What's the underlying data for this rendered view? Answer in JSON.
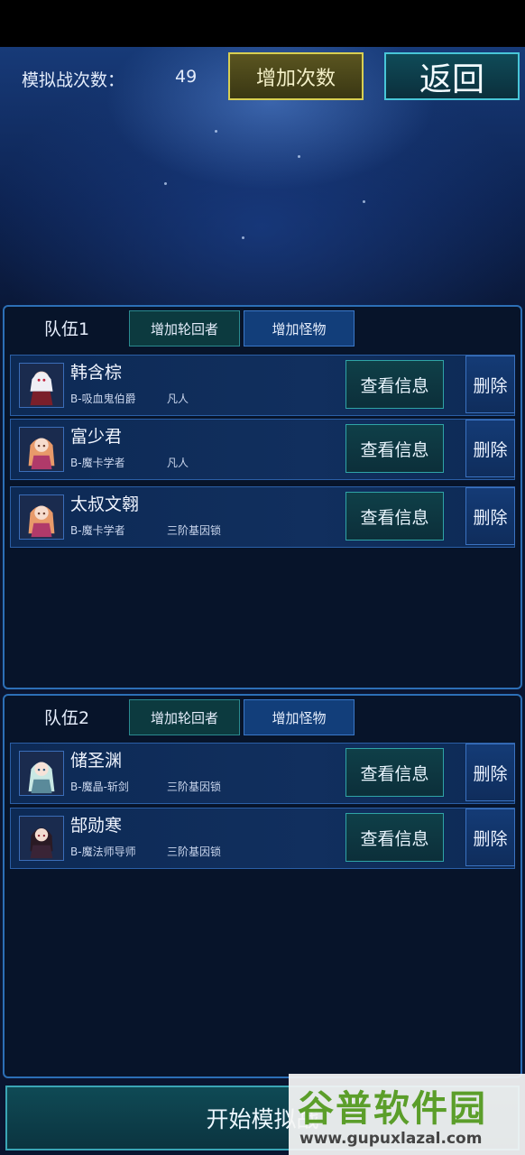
{
  "header": {
    "count_label": "模拟战次数：",
    "count_value": "49",
    "add_count_button": "增加次数",
    "back_button": "返回"
  },
  "teams": [
    {
      "title": "队伍1",
      "add_reincarnator": "增加轮回者",
      "add_monster": "增加怪物",
      "members": [
        {
          "name": "韩含棕",
          "class": "B-吸血鬼伯爵",
          "rank": "凡人",
          "info": "查看信息",
          "delete": "删除",
          "avatar_icon": "vampire-girl-avatar-icon"
        },
        {
          "name": "富少君",
          "class": "B-魔卡学者",
          "rank": "凡人",
          "info": "查看信息",
          "delete": "删除",
          "avatar_icon": "card-scholar-avatar-icon"
        },
        {
          "name": "太叔文翱",
          "class": "B-魔卡学者",
          "rank": "三阶基因锁",
          "info": "查看信息",
          "delete": "删除",
          "avatar_icon": "card-scholar-avatar-icon"
        }
      ]
    },
    {
      "title": "队伍2",
      "add_reincarnator": "增加轮回者",
      "add_monster": "增加怪物",
      "members": [
        {
          "name": "储圣渊",
          "class": "B-魔晶-斩剑",
          "rank": "三阶基因锁",
          "info": "查看信息",
          "delete": "删除",
          "avatar_icon": "swordsman-avatar-icon"
        },
        {
          "name": "郜勋寒",
          "class": "B-魔法师导师",
          "rank": "三阶基因锁",
          "info": "查看信息",
          "delete": "删除",
          "avatar_icon": "mage-mentor-avatar-icon"
        }
      ]
    }
  ],
  "footer": {
    "start_button": "开始模拟战"
  },
  "watermark": {
    "title": "谷普软件园",
    "url": "www.gupuxlazal.com"
  },
  "colors": {
    "background": "#0a1530",
    "panel_border": "#2c6fb6",
    "add_count_border": "#d8cf52",
    "back_border": "#48c6d8"
  }
}
